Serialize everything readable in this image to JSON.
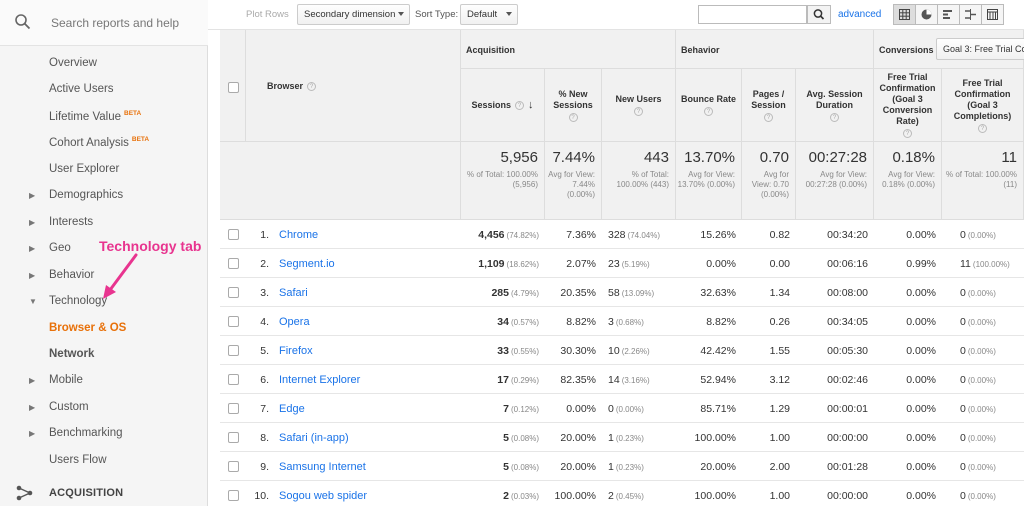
{
  "sidebar": {
    "search_placeholder": "Search reports and help",
    "items": [
      {
        "label": "Overview"
      },
      {
        "label": "Active Users"
      },
      {
        "label": "Lifetime Value",
        "badge": "BETA"
      },
      {
        "label": "Cohort Analysis",
        "badge": "BETA"
      },
      {
        "label": "User Explorer"
      },
      {
        "label": "Demographics",
        "arrow": "▶"
      },
      {
        "label": "Interests",
        "arrow": "▶"
      },
      {
        "label": "Geo",
        "arrow": "▶"
      },
      {
        "label": "Behavior",
        "arrow": "▶"
      },
      {
        "label": "Technology",
        "arrow": "▼"
      },
      {
        "label": "Browser & OS"
      },
      {
        "label": "Network"
      },
      {
        "label": "Mobile",
        "arrow": "▶"
      },
      {
        "label": "Custom",
        "arrow": "▶"
      },
      {
        "label": "Benchmarking",
        "arrow": "▶"
      },
      {
        "label": "Users Flow"
      }
    ],
    "acquisition_label": "ACQUISITION"
  },
  "annotation": {
    "text": "Technology tab",
    "color": "#e8348f"
  },
  "toolbar": {
    "plot_rows": "Plot Rows",
    "secondary_dimension": "Secondary dimension",
    "sort_type_label": "Sort Type:",
    "sort_type_value": "Default",
    "advanced": "advanced"
  },
  "table": {
    "group_acquisition": "Acquisition",
    "group_behavior": "Behavior",
    "group_conversions": "Conversions",
    "goal_select": "Goal 3: Free Trial Co",
    "dimension": "Browser",
    "columns": [
      "Sessions",
      "% New Sessions",
      "New Users",
      "Bounce Rate",
      "Pages / Session",
      "Avg. Session Duration",
      "Free Trial Confirmation (Goal 3 Conversion Rate)",
      "Free Trial Confirmation (Goal 3 Completions)"
    ],
    "totals": [
      {
        "big": "5,956",
        "small": "% of Total: 100.00% (5,956)"
      },
      {
        "big": "7.44%",
        "small": "Avg for View: 7.44% (0.00%)"
      },
      {
        "big": "443",
        "small": "% of Total: 100.00% (443)"
      },
      {
        "big": "13.70%",
        "small": "Avg for View: 13.70% (0.00%)"
      },
      {
        "big": "0.70",
        "small": "Avg for View: 0.70 (0.00%)"
      },
      {
        "big": "00:27:28",
        "small": "Avg for View: 00:27:28 (0.00%)"
      },
      {
        "big": "0.18%",
        "small": "Avg for View: 0.18% (0.00%)"
      },
      {
        "big": "11",
        "small": "% of Total: 100.00% (11)"
      }
    ],
    "rows": [
      {
        "rank": "1.",
        "browser": "Chrome",
        "sessions": "4,456",
        "sessions_pct": "(74.82%)",
        "new_sessions": "7.36%",
        "new_users": "328",
        "new_users_pct": "(74.04%)",
        "bounce": "15.26%",
        "pages": "0.82",
        "duration": "00:34:20",
        "conv_rate": "0.00%",
        "completions": "0",
        "completions_pct": "(0.00%)"
      },
      {
        "rank": "2.",
        "browser": "Segment.io",
        "sessions": "1,109",
        "sessions_pct": "(18.62%)",
        "new_sessions": "2.07%",
        "new_users": "23",
        "new_users_pct": "(5.19%)",
        "bounce": "0.00%",
        "pages": "0.00",
        "duration": "00:06:16",
        "conv_rate": "0.99%",
        "completions": "11",
        "completions_pct": "(100.00%)"
      },
      {
        "rank": "3.",
        "browser": "Safari",
        "sessions": "285",
        "sessions_pct": "(4.79%)",
        "new_sessions": "20.35%",
        "new_users": "58",
        "new_users_pct": "(13.09%)",
        "bounce": "32.63%",
        "pages": "1.34",
        "duration": "00:08:00",
        "conv_rate": "0.00%",
        "completions": "0",
        "completions_pct": "(0.00%)"
      },
      {
        "rank": "4.",
        "browser": "Opera",
        "sessions": "34",
        "sessions_pct": "(0.57%)",
        "new_sessions": "8.82%",
        "new_users": "3",
        "new_users_pct": "(0.68%)",
        "bounce": "8.82%",
        "pages": "0.26",
        "duration": "00:34:05",
        "conv_rate": "0.00%",
        "completions": "0",
        "completions_pct": "(0.00%)"
      },
      {
        "rank": "5.",
        "browser": "Firefox",
        "sessions": "33",
        "sessions_pct": "(0.55%)",
        "new_sessions": "30.30%",
        "new_users": "10",
        "new_users_pct": "(2.26%)",
        "bounce": "42.42%",
        "pages": "1.55",
        "duration": "00:05:30",
        "conv_rate": "0.00%",
        "completions": "0",
        "completions_pct": "(0.00%)"
      },
      {
        "rank": "6.",
        "browser": "Internet Explorer",
        "sessions": "17",
        "sessions_pct": "(0.29%)",
        "new_sessions": "82.35%",
        "new_users": "14",
        "new_users_pct": "(3.16%)",
        "bounce": "52.94%",
        "pages": "3.12",
        "duration": "00:02:46",
        "conv_rate": "0.00%",
        "completions": "0",
        "completions_pct": "(0.00%)"
      },
      {
        "rank": "7.",
        "browser": "Edge",
        "sessions": "7",
        "sessions_pct": "(0.12%)",
        "new_sessions": "0.00%",
        "new_users": "0",
        "new_users_pct": "(0.00%)",
        "bounce": "85.71%",
        "pages": "1.29",
        "duration": "00:00:01",
        "conv_rate": "0.00%",
        "completions": "0",
        "completions_pct": "(0.00%)"
      },
      {
        "rank": "8.",
        "browser": "Safari (in-app)",
        "sessions": "5",
        "sessions_pct": "(0.08%)",
        "new_sessions": "20.00%",
        "new_users": "1",
        "new_users_pct": "(0.23%)",
        "bounce": "100.00%",
        "pages": "1.00",
        "duration": "00:00:00",
        "conv_rate": "0.00%",
        "completions": "0",
        "completions_pct": "(0.00%)"
      },
      {
        "rank": "9.",
        "browser": "Samsung Internet",
        "sessions": "5",
        "sessions_pct": "(0.08%)",
        "new_sessions": "20.00%",
        "new_users": "1",
        "new_users_pct": "(0.23%)",
        "bounce": "20.00%",
        "pages": "2.00",
        "duration": "00:01:28",
        "conv_rate": "0.00%",
        "completions": "0",
        "completions_pct": "(0.00%)"
      },
      {
        "rank": "10.",
        "browser": "Sogou web spider",
        "sessions": "2",
        "sessions_pct": "(0.03%)",
        "new_sessions": "100.00%",
        "new_users": "2",
        "new_users_pct": "(0.45%)",
        "bounce": "100.00%",
        "pages": "1.00",
        "duration": "00:00:00",
        "conv_rate": "0.00%",
        "completions": "0",
        "completions_pct": "(0.00%)"
      }
    ]
  },
  "colors": {
    "accent_orange": "#e8710a",
    "link_blue": "#1a73e8",
    "annotation_pink": "#e8348f"
  }
}
